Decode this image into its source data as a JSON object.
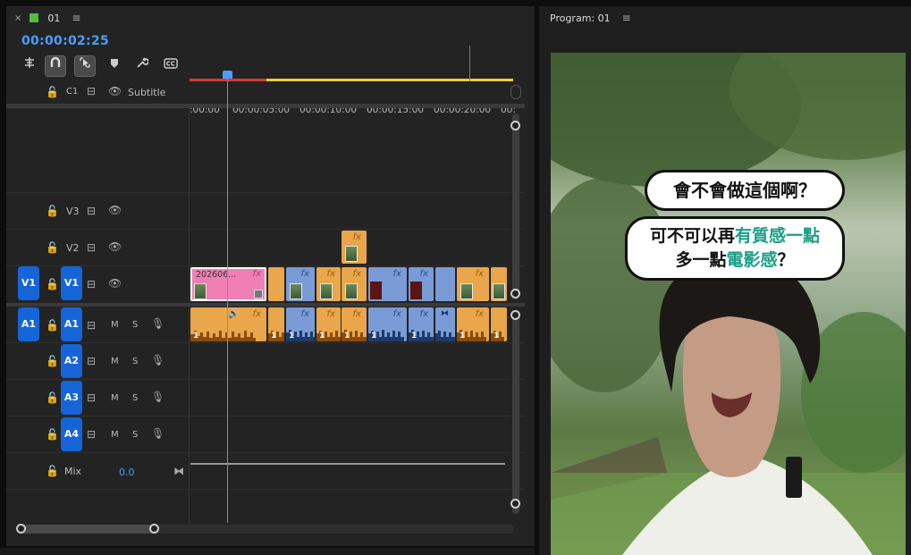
{
  "timeline": {
    "tab_close": "×",
    "tab_title": "01",
    "tab_menu": "≡",
    "timecode": "00:00:02:25",
    "ruler": [
      ":00:00",
      "00:00:05:00",
      "00:00:10:00",
      "00:00:15:00",
      "00:00:20:00",
      "00:"
    ],
    "subtitle_track": {
      "id": "C1",
      "name": "Subtitle"
    },
    "video_tracks": [
      {
        "id": "V3"
      },
      {
        "id": "V2"
      },
      {
        "id": "V1",
        "source": "V1"
      }
    ],
    "audio_tracks": [
      {
        "id": "A1",
        "source": "A1",
        "m": "M",
        "s": "S"
      },
      {
        "id": "A2",
        "m": "M",
        "s": "S"
      },
      {
        "id": "A3",
        "m": "M",
        "s": "S"
      },
      {
        "id": "A4",
        "m": "M",
        "s": "S"
      }
    ],
    "mix": {
      "label": "Mix",
      "value": "0.0"
    },
    "clip_label": "202606...",
    "fx": "fx",
    "audio_num": "1"
  },
  "program": {
    "title": "Program: 01",
    "menu": "≡",
    "bubble1": "會不會做這個啊？",
    "bubble2_line1_a": "可不可以再",
    "bubble2_line1_b": "有質感一點",
    "bubble2_line2_a": "多一點",
    "bubble2_line2_b": "電影感",
    "bubble2_line2_c": "？"
  },
  "colors": {
    "accent": "#4a9eff",
    "track_button": "#1565d8",
    "clip_orange": "#e9a64a",
    "clip_blue": "#7a9bd6",
    "clip_pink": "#f07fb4",
    "subtitle_teal": "#1a9f86"
  }
}
